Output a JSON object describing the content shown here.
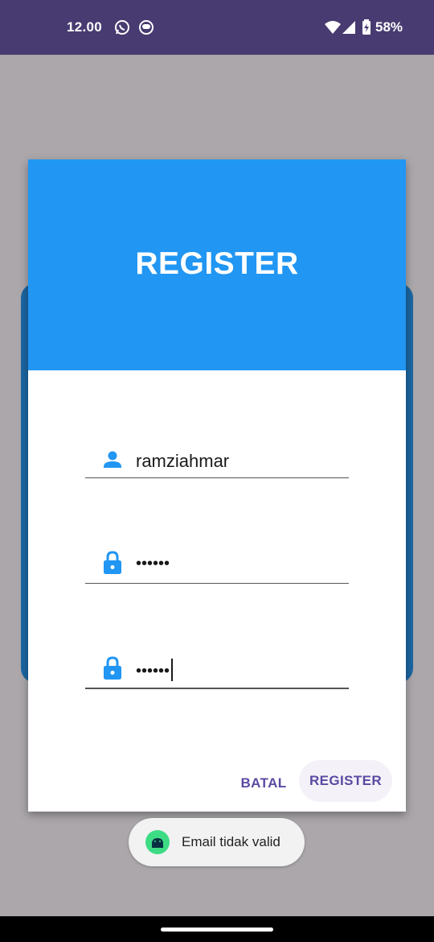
{
  "status_bar": {
    "time": "12.00",
    "battery": "58%",
    "icons": [
      "whatsapp-icon",
      "app-notification-icon",
      "wifi-icon",
      "signal-icon",
      "battery-icon"
    ]
  },
  "dialog": {
    "title": "REGISTER",
    "fields": [
      {
        "icon": "person-icon",
        "value": "ramziahmar"
      },
      {
        "icon": "lock-icon",
        "value": "••••••"
      },
      {
        "icon": "lock-icon",
        "value": "••••••"
      }
    ],
    "cancel_label": "BATAL",
    "register_label": "REGISTER"
  },
  "toast": {
    "icon": "android-icon",
    "message": "Email tidak valid"
  },
  "colors": {
    "status_bar": "#483b71",
    "header": "#2196f3",
    "accent_text": "#5b49a2",
    "scrim": "#aba7ab",
    "background_card": "#1c66a2"
  }
}
